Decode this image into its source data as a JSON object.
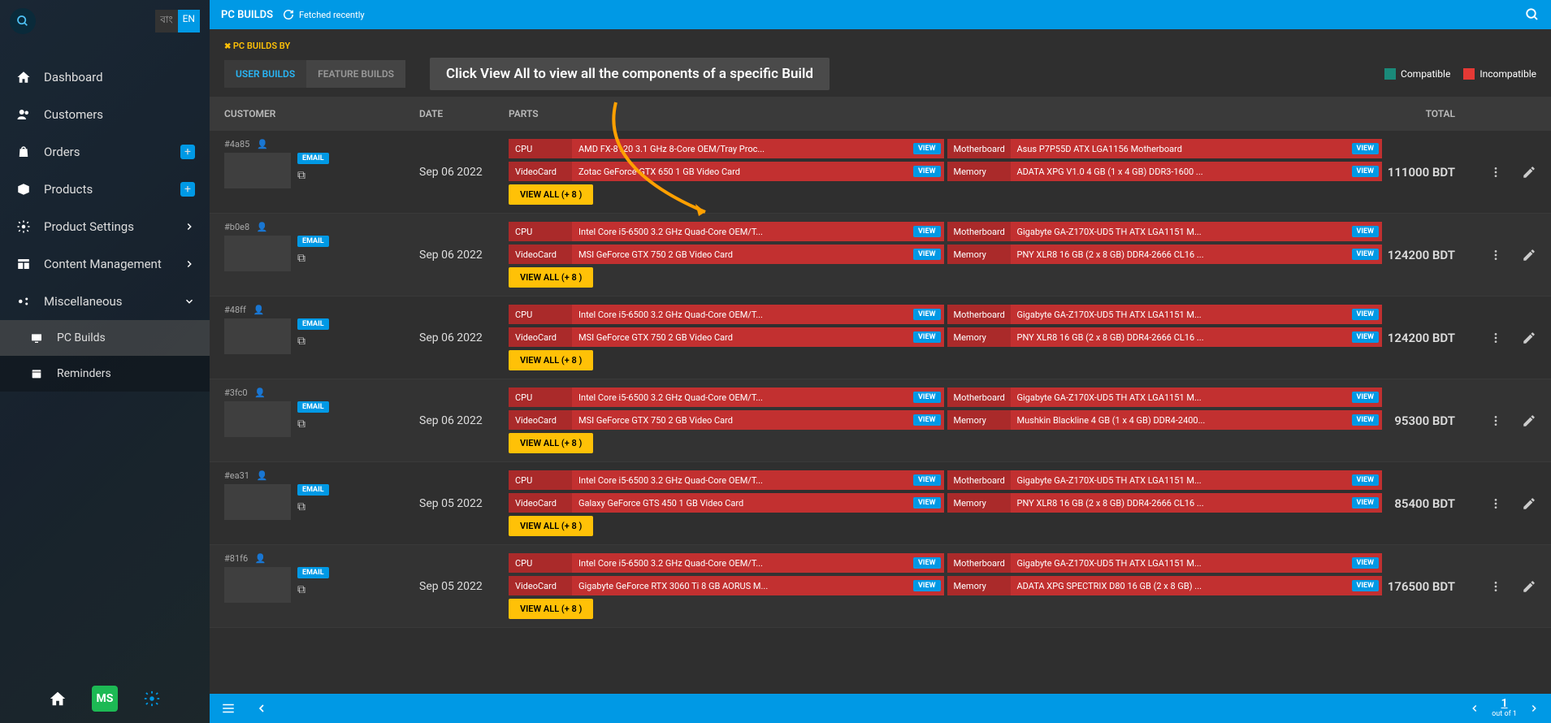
{
  "lang": {
    "bn": "বাং",
    "en": "EN"
  },
  "sidebar": {
    "items": [
      {
        "label": "Dashboard"
      },
      {
        "label": "Customers"
      },
      {
        "label": "Orders"
      },
      {
        "label": "Products"
      },
      {
        "label": "Product Settings"
      },
      {
        "label": "Content Management"
      },
      {
        "label": "Miscellaneous"
      }
    ],
    "sub": [
      {
        "label": "PC Builds"
      },
      {
        "label": "Reminders"
      }
    ],
    "logo": "MS"
  },
  "topbar": {
    "title": "PC BUILDS",
    "fetched": "Fetched recently"
  },
  "section": {
    "breadcrumb": "PC BUILDS BY",
    "tabs": [
      {
        "label": "USER BUILDS",
        "active": true
      },
      {
        "label": "FEATURE BUILDS",
        "active": false
      }
    ],
    "tooltip": "Click View All to view all the components of a specific Build",
    "legend": {
      "compatible": "Compatible",
      "incompatible": "Incompatible"
    }
  },
  "columns": {
    "customer": "CUSTOMER",
    "date": "DATE",
    "parts": "PARTS",
    "total": "TOTAL"
  },
  "labels": {
    "email": "EMAIL",
    "view": "VIEW",
    "viewAll": "VIEW ALL (+ 8 )"
  },
  "rows": [
    {
      "id": "#4a85",
      "date": "Sep 06 2022",
      "total": "111000 BDT",
      "parts": [
        {
          "type": "CPU",
          "name": "AMD FX-8120 3.1 GHz 8-Core OEM/Tray Proc..."
        },
        {
          "type": "Motherboard",
          "name": "Asus P7P55D ATX LGA1156 Motherboard"
        },
        {
          "type": "VideoCard",
          "name": "Zotac GeForce GTX 650 1 GB Video Card"
        },
        {
          "type": "Memory",
          "name": "ADATA XPG V1.0 4 GB (1 x 4 GB) DDR3-1600 ..."
        }
      ]
    },
    {
      "id": "#b0e8",
      "date": "Sep 06 2022",
      "total": "124200 BDT",
      "parts": [
        {
          "type": "CPU",
          "name": "Intel Core i5-6500 3.2 GHz Quad-Core OEM/T..."
        },
        {
          "type": "Motherboard",
          "name": "Gigabyte GA-Z170X-UD5 TH ATX LGA1151 M..."
        },
        {
          "type": "VideoCard",
          "name": "MSI GeForce GTX 750 2 GB Video Card"
        },
        {
          "type": "Memory",
          "name": "PNY XLR8 16 GB (2 x 8 GB) DDR4-2666 CL16 ..."
        }
      ]
    },
    {
      "id": "#48ff",
      "date": "Sep 06 2022",
      "total": "124200 BDT",
      "parts": [
        {
          "type": "CPU",
          "name": "Intel Core i5-6500 3.2 GHz Quad-Core OEM/T..."
        },
        {
          "type": "Motherboard",
          "name": "Gigabyte GA-Z170X-UD5 TH ATX LGA1151 M..."
        },
        {
          "type": "VideoCard",
          "name": "MSI GeForce GTX 750 2 GB Video Card"
        },
        {
          "type": "Memory",
          "name": "PNY XLR8 16 GB (2 x 8 GB) DDR4-2666 CL16 ..."
        }
      ]
    },
    {
      "id": "#3fc0",
      "date": "Sep 06 2022",
      "total": "95300 BDT",
      "parts": [
        {
          "type": "CPU",
          "name": "Intel Core i5-6500 3.2 GHz Quad-Core OEM/T..."
        },
        {
          "type": "Motherboard",
          "name": "Gigabyte GA-Z170X-UD5 TH ATX LGA1151 M..."
        },
        {
          "type": "VideoCard",
          "name": "MSI GeForce GTX 750 2 GB Video Card"
        },
        {
          "type": "Memory",
          "name": "Mushkin Blackline 4 GB (1 x 4 GB) DDR4-2400..."
        }
      ]
    },
    {
      "id": "#ea31",
      "date": "Sep 05 2022",
      "total": "85400 BDT",
      "parts": [
        {
          "type": "CPU",
          "name": "Intel Core i5-6500 3.2 GHz Quad-Core OEM/T..."
        },
        {
          "type": "Motherboard",
          "name": "Gigabyte GA-Z170X-UD5 TH ATX LGA1151 M..."
        },
        {
          "type": "VideoCard",
          "name": "Galaxy GeForce GTS 450 1 GB Video Card"
        },
        {
          "type": "Memory",
          "name": "PNY XLR8 16 GB (2 x 8 GB) DDR4-2666 CL16 ..."
        }
      ]
    },
    {
      "id": "#81f6",
      "date": "Sep 05 2022",
      "total": "176500 BDT",
      "parts": [
        {
          "type": "CPU",
          "name": "Intel Core i5-6500 3.2 GHz Quad-Core OEM/T..."
        },
        {
          "type": "Motherboard",
          "name": "Gigabyte GA-Z170X-UD5 TH ATX LGA1151 M..."
        },
        {
          "type": "VideoCard",
          "name": "Gigabyte GeForce RTX 3060 Ti 8 GB AORUS M..."
        },
        {
          "type": "Memory",
          "name": "ADATA XPG SPECTRIX D80 16 GB (2 x 8 GB) ..."
        }
      ]
    }
  ],
  "pagination": {
    "page": "1",
    "of": "out of 1"
  }
}
